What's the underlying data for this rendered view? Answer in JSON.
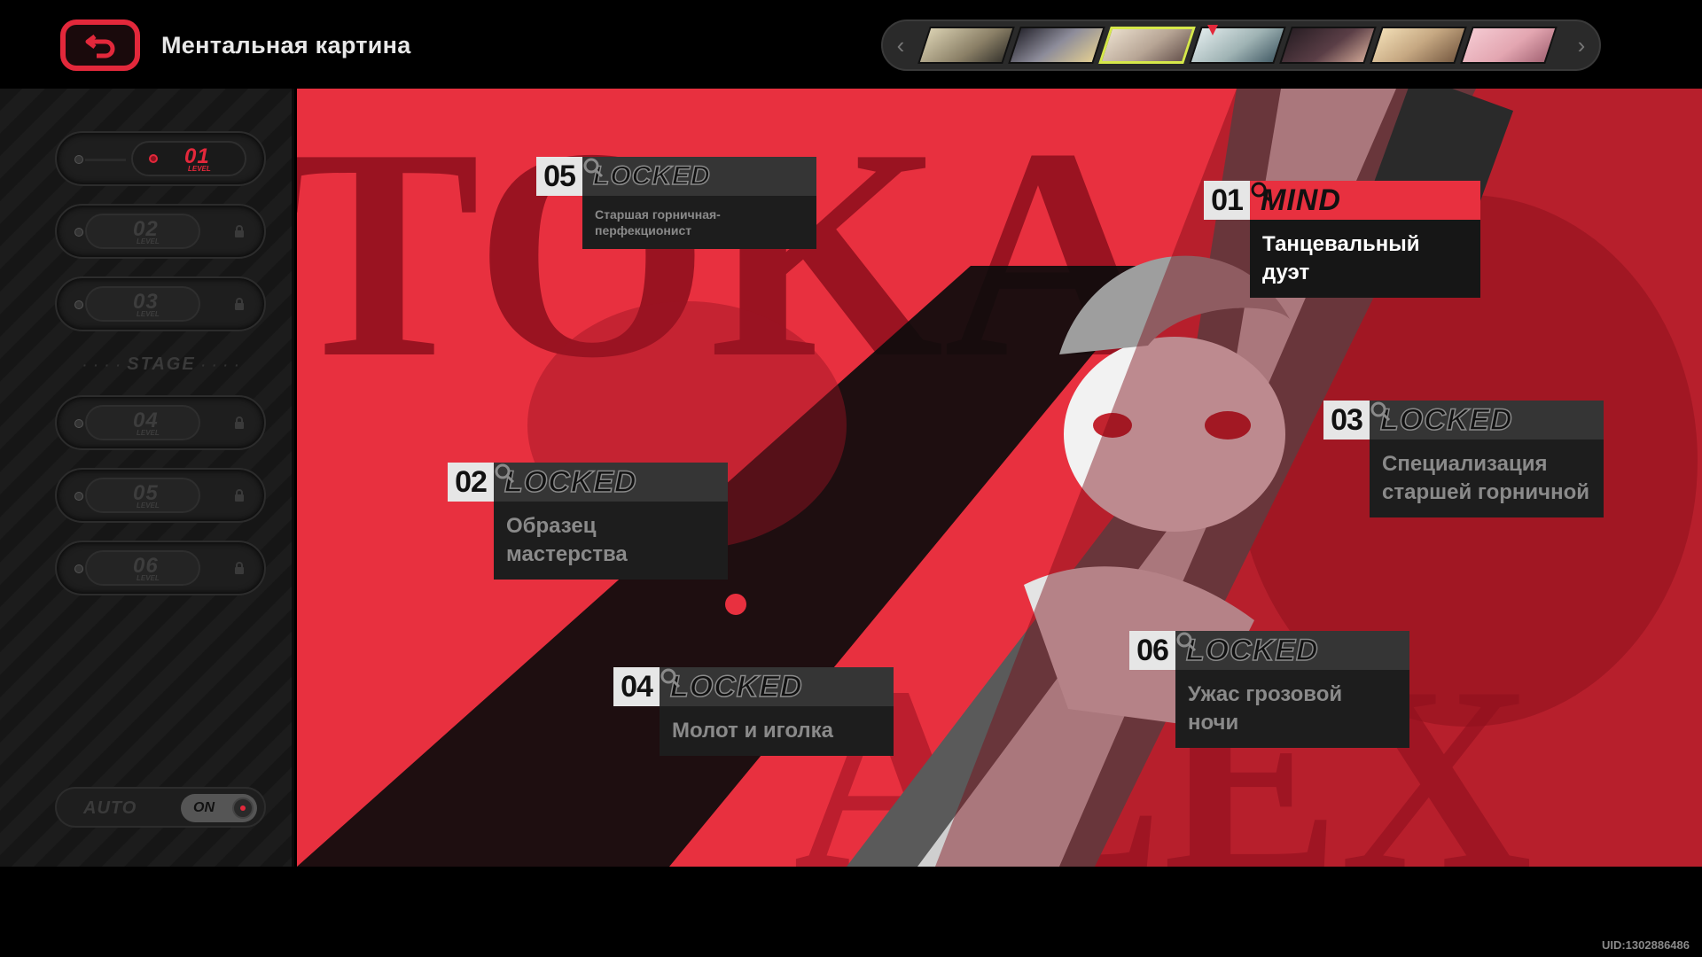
{
  "header": {
    "title": "Ментальная картина",
    "back_icon": "return-arrow-icon"
  },
  "character_strip": {
    "left_arrow": "‹",
    "right_arrow": "›",
    "portraits": [
      {
        "name": "portrait-1",
        "color": "#b9ac8a"
      },
      {
        "name": "portrait-2",
        "color": "#6f6a6e"
      },
      {
        "name": "portrait-3",
        "color": "#cbb8a3",
        "active": true
      },
      {
        "name": "portrait-4",
        "color": "#9fb3b4"
      },
      {
        "name": "portrait-5",
        "color": "#4b3a40"
      },
      {
        "name": "portrait-6",
        "color": "#c6a882"
      },
      {
        "name": "portrait-7",
        "color": "#e3a6b1"
      }
    ]
  },
  "sidebar": {
    "levels": [
      {
        "num": "01",
        "sub": "LEVEL",
        "active": true
      },
      {
        "num": "02",
        "sub": "LEVEL",
        "locked": true
      },
      {
        "num": "03",
        "sub": "LEVEL",
        "locked": true
      },
      {
        "num": "04",
        "sub": "LEVEL",
        "locked": true
      },
      {
        "num": "05",
        "sub": "LEVEL",
        "locked": true
      },
      {
        "num": "06",
        "sub": "LEVEL",
        "locked": true
      }
    ],
    "stage_label": "STAGE",
    "auto_label": "AUTO",
    "auto_toggle": "ON"
  },
  "art": {
    "bg_text_top": "TOKA",
    "bg_text_bottom": "ALEX",
    "accent": "#e8303f"
  },
  "nodes": [
    {
      "num": "05",
      "state": "LOCKED",
      "title": "Старшая горничная-перфекционист"
    },
    {
      "num": "01",
      "state": "MIND",
      "title": "Танцевальный дуэт"
    },
    {
      "num": "03",
      "state": "LOCKED",
      "title": "Специализация старшей горничной"
    },
    {
      "num": "02",
      "state": "LOCKED",
      "title": "Образец мастерства"
    },
    {
      "num": "04",
      "state": "LOCKED",
      "title": "Молот и иголка"
    },
    {
      "num": "06",
      "state": "LOCKED",
      "title": "Ужас грозовой ночи"
    }
  ],
  "footer": {
    "uid": "UID:1302886486"
  }
}
